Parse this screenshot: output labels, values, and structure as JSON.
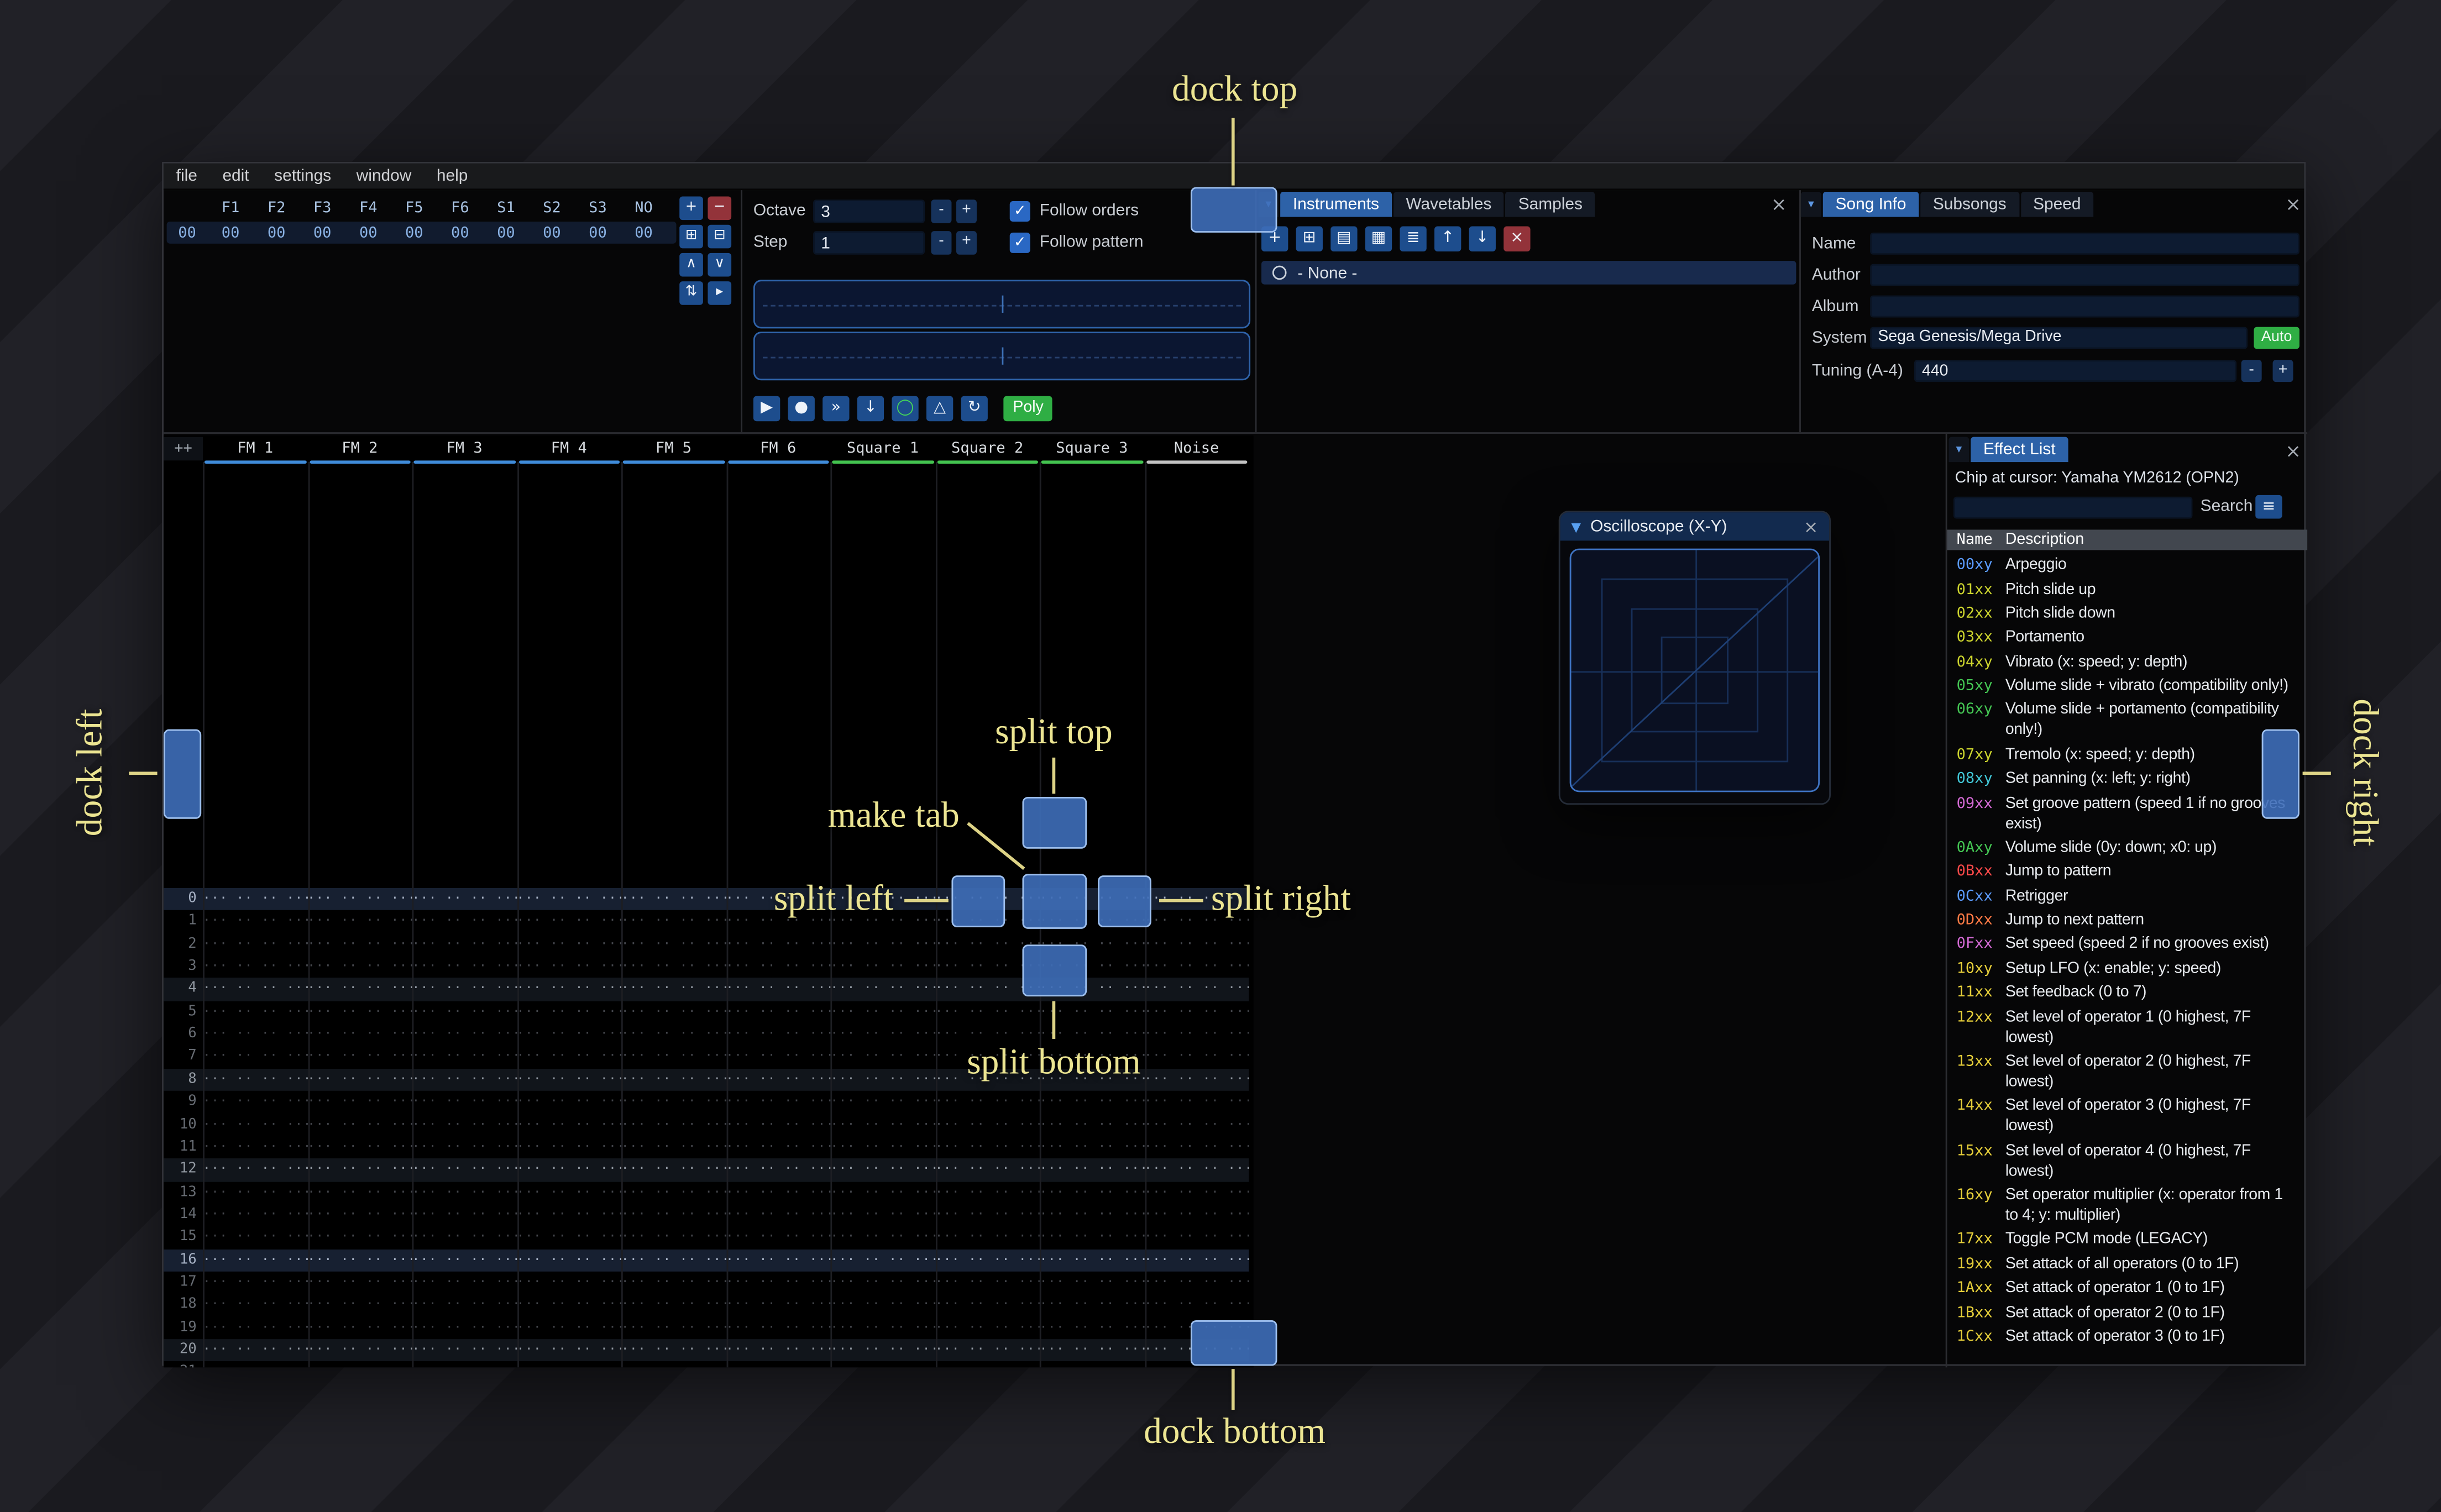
{
  "ui": {
    "dropdown_glyph": "▾",
    "collapse_glyph": "▼",
    "close_glyph": "×",
    "check_glyph": "✓",
    "hamburger_glyph": "≡"
  },
  "menu": {
    "items": [
      "file",
      "edit",
      "settings",
      "window",
      "help"
    ]
  },
  "orders": {
    "row_label": "00",
    "channels": [
      "F1",
      "F2",
      "F3",
      "F4",
      "F5",
      "F6",
      "S1",
      "S2",
      "S3",
      "NO"
    ],
    "values": [
      "00",
      "00",
      "00",
      "00",
      "00",
      "00",
      "00",
      "00",
      "00",
      "00"
    ],
    "buttons": [
      {
        "name": "add-order-button",
        "glyph": "+",
        "style": "blue"
      },
      {
        "name": "remove-order-button",
        "glyph": "−",
        "style": "red"
      },
      {
        "name": "duplicate-order-button",
        "glyph": "⊞",
        "style": "blue"
      },
      {
        "name": "deep-clone-order-button",
        "glyph": "⊟",
        "style": "blue"
      },
      {
        "name": "move-order-up-button",
        "glyph": "∧",
        "style": "blue"
      },
      {
        "name": "move-order-down-button",
        "glyph": "∨",
        "style": "blue"
      },
      {
        "name": "change-all-orders-button",
        "glyph": "⇅",
        "style": "blue"
      },
      {
        "name": "order-edit-mode-button",
        "glyph": "▸",
        "style": "blue"
      }
    ]
  },
  "playbar": {
    "octave_label": "Octave",
    "octave_value": "3",
    "step_label": "Step",
    "step_value": "1",
    "minus_label": "-",
    "plus_label": "+",
    "follow_orders_label": "Follow orders",
    "follow_pattern_label": "Follow pattern",
    "buttons": [
      {
        "name": "play-button",
        "glyph": "▶"
      },
      {
        "name": "stop-button",
        "glyph": "●"
      },
      {
        "name": "play-from-cursor-button",
        "glyph": "»"
      },
      {
        "name": "step-row-button",
        "glyph": "↓"
      },
      {
        "name": "record-button",
        "glyph": "◯",
        "accent": "#45d658"
      },
      {
        "name": "metronome-button",
        "glyph": "△"
      },
      {
        "name": "repeat-pattern-button",
        "glyph": "↻"
      }
    ],
    "poly_label": "Poly"
  },
  "assets": {
    "tabs": [
      {
        "label": "Instruments",
        "active": true
      },
      {
        "label": "Wavetables",
        "active": false
      },
      {
        "label": "Samples",
        "active": false
      }
    ],
    "toolbar": [
      {
        "name": "add-instrument-button",
        "glyph": "+",
        "style": "blue"
      },
      {
        "name": "duplicate-instrument-button",
        "glyph": "⊞",
        "style": "blue"
      },
      {
        "name": "open-instrument-button",
        "glyph": "▤",
        "style": "blue"
      },
      {
        "name": "save-instrument-button",
        "glyph": "▦",
        "style": "blue"
      },
      {
        "name": "toggle-folders-button",
        "glyph": "≣",
        "style": "blue"
      },
      {
        "name": "move-instrument-up-button",
        "glyph": "↑",
        "style": "blue"
      },
      {
        "name": "move-instrument-down-button",
        "glyph": "↓",
        "style": "blue"
      },
      {
        "name": "delete-instrument-button",
        "glyph": "×",
        "style": "red"
      }
    ],
    "selected_item": "- None -"
  },
  "song_info": {
    "tabs": [
      {
        "label": "Song Info",
        "active": true
      },
      {
        "label": "Subsongs",
        "active": false
      },
      {
        "label": "Speed",
        "active": false
      }
    ],
    "name_label": "Name",
    "author_label": "Author",
    "album_label": "Album",
    "system_label": "System",
    "system_value": "Sega Genesis/Mega Drive",
    "auto_label": "Auto",
    "tuning_label": "Tuning (A-4)",
    "tuning_value": "440",
    "minus_label": "-",
    "plus_label": "+"
  },
  "pattern": {
    "corner_label": "++",
    "channels": [
      {
        "label": "FM 1",
        "type": "fm"
      },
      {
        "label": "FM 2",
        "type": "fm"
      },
      {
        "label": "FM 3",
        "type": "fm"
      },
      {
        "label": "FM 4",
        "type": "fm"
      },
      {
        "label": "FM 5",
        "type": "fm"
      },
      {
        "label": "FM 6",
        "type": "fm"
      },
      {
        "label": "Square 1",
        "type": "square"
      },
      {
        "label": "Square 2",
        "type": "square"
      },
      {
        "label": "Square 3",
        "type": "square"
      },
      {
        "label": "Noise",
        "type": "noise"
      }
    ],
    "type_colors": {
      "fm": "#3f8bd9",
      "square": "#43c24f",
      "noise": "#c2c2c2"
    },
    "rows": 22,
    "empty_cell": "··· ·· ·· ····",
    "highlight1_every": 4,
    "highlight2_every": 16
  },
  "oscilloscope": {
    "title": "Oscilloscope (X-Y)"
  },
  "effect_list": {
    "tab_label": "Effect List",
    "chip_line": "Chip at cursor: Yamaha YM2612 (OPN2)",
    "search_label": "Search",
    "columns": {
      "name": "Name",
      "description": "Description"
    },
    "rows": [
      {
        "code": "00xy",
        "desc": "Arpeggio",
        "color": "#5b9bff"
      },
      {
        "code": "01xx",
        "desc": "Pitch slide up",
        "color": "#ccd42e"
      },
      {
        "code": "02xx",
        "desc": "Pitch slide down",
        "color": "#ccd42e"
      },
      {
        "code": "03xx",
        "desc": "Portamento",
        "color": "#ccd42e"
      },
      {
        "code": "04xy",
        "desc": "Vibrato (x: speed; y: depth)",
        "color": "#ccd42e"
      },
      {
        "code": "05xy",
        "desc": "Volume slide + vibrato (compatibility only!)",
        "color": "#44c653"
      },
      {
        "code": "06xy",
        "desc": "Volume slide + portamento (compatibility only!)",
        "color": "#44c653"
      },
      {
        "code": "07xy",
        "desc": "Tremolo (x: speed; y: depth)",
        "color": "#ccd42e"
      },
      {
        "code": "08xy",
        "desc": "Set panning (x: left; y: right)",
        "color": "#42c8d8"
      },
      {
        "code": "09xx",
        "desc": "Set groove pattern (speed 1 if no grooves exist)",
        "color": "#d46ad4"
      },
      {
        "code": "0Axy",
        "desc": "Volume slide (0y: down; x0: up)",
        "color": "#44c653"
      },
      {
        "code": "0Bxx",
        "desc": "Jump to pattern",
        "color": "#ff4a4a"
      },
      {
        "code": "0Cxx",
        "desc": "Retrigger",
        "color": "#5b9bff"
      },
      {
        "code": "0Dxx",
        "desc": "Jump to next pattern",
        "color": "#ff7a45"
      },
      {
        "code": "0Fxx",
        "desc": "Set speed (speed 2 if no grooves exist)",
        "color": "#d46ad4"
      },
      {
        "code": "10xy",
        "desc": "Setup LFO (x: enable; y: speed)",
        "color": "#e5ce3a"
      },
      {
        "code": "11xx",
        "desc": "Set feedback (0 to 7)",
        "color": "#e5ce3a"
      },
      {
        "code": "12xx",
        "desc": "Set level of operator 1 (0 highest, 7F lowest)",
        "color": "#e5ce3a"
      },
      {
        "code": "13xx",
        "desc": "Set level of operator 2 (0 highest, 7F lowest)",
        "color": "#e5ce3a"
      },
      {
        "code": "14xx",
        "desc": "Set level of operator 3 (0 highest, 7F lowest)",
        "color": "#e5ce3a"
      },
      {
        "code": "15xx",
        "desc": "Set level of operator 4 (0 highest, 7F lowest)",
        "color": "#e5ce3a"
      },
      {
        "code": "16xy",
        "desc": "Set operator multiplier (x: operator from 1 to 4; y: multiplier)",
        "color": "#e5ce3a"
      },
      {
        "code": "17xx",
        "desc": "Toggle PCM mode (LEGACY)",
        "color": "#e5ce3a"
      },
      {
        "code": "19xx",
        "desc": "Set attack of all operators (0 to 1F)",
        "color": "#e5ce3a"
      },
      {
        "code": "1Axx",
        "desc": "Set attack of operator 1 (0 to 1F)",
        "color": "#e5ce3a"
      },
      {
        "code": "1Bxx",
        "desc": "Set attack of operator 2 (0 to 1F)",
        "color": "#e5ce3a"
      },
      {
        "code": "1Cxx",
        "desc": "Set attack of operator 3 (0 to 1F)",
        "color": "#e5ce3a"
      }
    ]
  },
  "dock_overlay": {
    "labels": {
      "dock_top": "dock top",
      "dock_bottom": "dock bottom",
      "dock_left": "dock left",
      "dock_right": "dock right",
      "split_top": "split top",
      "split_bottom": "split bottom",
      "split_left": "split left",
      "split_right": "split right",
      "make_tab": "make tab"
    },
    "label_color": "#ece592",
    "button_fill": "#3d6eb9",
    "button_border": "#9dbfee"
  }
}
